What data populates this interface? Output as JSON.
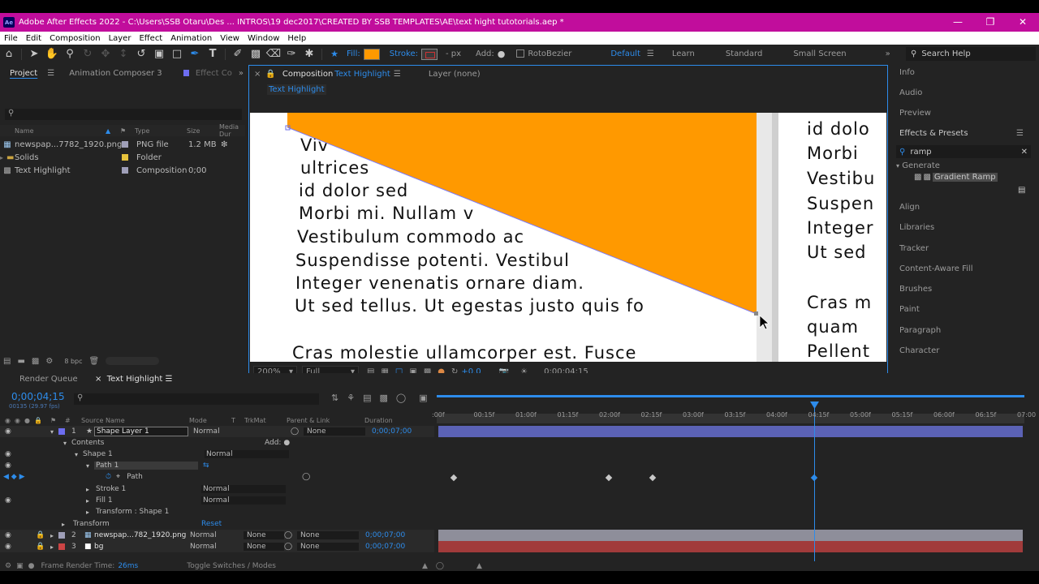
{
  "window": {
    "title": "Adobe After Effects 2022 - C:\\Users\\SSB Otaru\\Des ... INTROS\\19 dec2017\\CREATED BY SSB TEMPLATES\\AE\\text hight tutotorials.aep *",
    "logo": "Ae"
  },
  "menu": [
    "File",
    "Edit",
    "Composition",
    "Layer",
    "Effect",
    "Animation",
    "View",
    "Window",
    "Help"
  ],
  "toolbar": {
    "fill_label": "Fill:",
    "stroke_label": "Stroke:",
    "stroke_unit": "- px",
    "add_label": "Add:",
    "rotobezier": "RotoBezier",
    "workspaces": [
      "Default",
      "Learn",
      "Standard",
      "Small Screen"
    ],
    "search_help": "Search Help",
    "fill_color": "#ff9900"
  },
  "project": {
    "tabs": [
      "Project",
      "Animation Composer 3",
      "Effect Co"
    ],
    "search_icon": "search-icon",
    "columns": [
      "Name",
      "Type",
      "Size",
      "Media Dur"
    ],
    "items": [
      {
        "name": "newspap...7782_1920.png",
        "type": "PNG file",
        "size": "1.2 MB",
        "label_color": "#9f9fb8"
      },
      {
        "name": "Solids",
        "type": "Folder",
        "size": "",
        "label_color": "#e6c23c"
      },
      {
        "name": "Text Highlight",
        "type": "Composition",
        "size": "0;00",
        "label_color": "#9f9fb8"
      }
    ],
    "bpc": "8 bpc"
  },
  "composition": {
    "tab_prefix": "Composition",
    "tab_name": "Text Highlight",
    "layer_tab": "Layer  (none)",
    "breadcrumb": "Text Highlight",
    "text_left": [
      "Viv",
      "ultrices",
      "id dolor sed",
      "Morbi mi. Nullam v",
      "Vestibulum commodo ac",
      "Suspendisse potenti. Vestibul",
      "Integer venenatis ornare diam.",
      "Ut sed tellus. Ut egestas justo quis fo",
      "Cras molestie ullamcorper est. Fusce"
    ],
    "text_right": [
      "id dolo",
      "Morbi",
      "Vestibu",
      "Suspen",
      "Integer",
      "Ut sed",
      "Cras m",
      "quam",
      "Pellent"
    ],
    "zoom": "200%",
    "resolution": "Full",
    "exposure": "+0.0",
    "timecode": "0;00;04;15"
  },
  "right_panel": {
    "items_top": [
      "Info",
      "Audio",
      "Preview",
      "Effects & Presets"
    ],
    "search_value": "ramp",
    "tree_folder": "Generate",
    "tree_item": "Gradient Ramp",
    "items_bottom": [
      "Align",
      "Libraries",
      "Tracker",
      "Content-Aware Fill",
      "Brushes",
      "Paint",
      "Paragraph",
      "Character"
    ]
  },
  "timeline": {
    "tabs": [
      "Render Queue",
      "Text Highlight"
    ],
    "timecode": "0;00;04;15",
    "fps": "00135 (29.97 fps)",
    "col_headers": [
      "#",
      "Source Name",
      "Mode",
      "T",
      "TrkMat",
      "Parent & Link",
      "Duration"
    ],
    "layers": [
      {
        "num": "1",
        "name": "Shape Layer 1",
        "mode": "Normal",
        "trkmat": "",
        "parent": "None",
        "duration": "0;00;07;00"
      },
      {
        "num": "2",
        "name": "newspap...782_1920.png",
        "mode": "Normal",
        "trkmat": "None",
        "parent": "None",
        "duration": "0;00;07;00"
      },
      {
        "num": "3",
        "name": "bg",
        "mode": "Normal",
        "trkmat": "None",
        "parent": "None",
        "duration": "0;00;07;00"
      }
    ],
    "props": {
      "contents": "Contents",
      "add": "Add:",
      "shape1": "Shape 1",
      "shape1_mode": "Normal",
      "path1": "Path 1",
      "path": "Path",
      "stroke1": "Stroke 1",
      "stroke1_mode": "Normal",
      "fill1": "Fill 1",
      "fill1_mode": "Normal",
      "transform_shape": "Transform : Shape 1",
      "transform": "Transform",
      "reset": "Reset"
    },
    "ruler": [
      ":00f",
      "00:15f",
      "01:00f",
      "01:15f",
      "02:00f",
      "02:15f",
      "03:00f",
      "03:15f",
      "04:00f",
      "04:15f",
      "05:00f",
      "05:15f",
      "06:00f",
      "06:15f",
      "07:00"
    ],
    "footer_left": "Frame Render Time:",
    "footer_value": "26ms",
    "footer_mid": "Toggle Switches / Modes",
    "colors": {
      "shape_bar": "#5b62b5",
      "png_bar": "#8e8e9a",
      "bg_bar": "#a13b3b",
      "cti": "#2d8ceb"
    }
  }
}
